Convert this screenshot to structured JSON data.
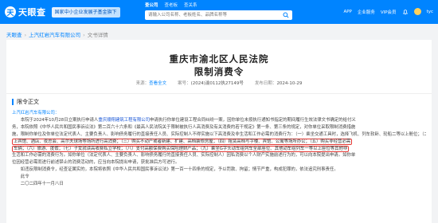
{
  "brand": {
    "logo_glyph": "天",
    "name": "天眼查",
    "banner": "国家中小企业发展子基金旗下"
  },
  "search": {
    "tabs": [
      "查公司",
      "查老板",
      "查关系"
    ],
    "placeholder": "请输入公司名称、老板姓名、品牌名称等"
  },
  "nav": {
    "app": "APP",
    "service": "企业服务",
    "vip": "VIP会员",
    "user": "tyc"
  },
  "breadcrumb": {
    "home": "天眼查",
    "company": "上汽红岩汽车有限公司",
    "current": "文书详情"
  },
  "document": {
    "court": "重庆市渝北区人民法院",
    "title": "限制消费令",
    "source_label": "来源：",
    "source": "查看全文",
    "case_label": "案号：",
    "case_no": "(2024)渝0112执27149号",
    "date_label": "发布日期：",
    "date": "2024-10-29",
    "section": "限令正文"
  },
  "body": {
    "l1": "上汽红岩汽车有限公司：",
    "l2a": "本院于2024年10月28日立案执行申请人",
    "l2b": "重庆顺翔建筑工程有限公司",
    "l2c": "申请执行你单位建设工程合同纠纷一案，因你单位未按执行通知书指定的期间履行生效法律文书确定的给付义",
    "l3": "务，本院依照《中华人民共和国民事诉讼法》第二百六十六条和《最高人民法院关于限制被执行人高消费及有关消费的若干规定》第一条、第三条的规定，对你单位采取限制消费措施",
    "l4": "施，限制你单位及你单位法定代表人、主要负责人、影响债务履行的直接责任人员、实际控制人不得实施以下高消费及非生活和工作必需的消费行为：（一）乘坐交通工具时，选择飞机、列车软卧、轮船二等以上舱位；（二）在星级以",
    "l5a": "上宾馆、酒店、夜总会、高尔夫球场等场所进行高消费；（三）购买不动产或者新建、扩建、高档装修房屋；（四）租赁高档写字楼、宾馆、公寓等场所办公；（五）购买非经营必需",
    "l5b": "车辆；（六）旅游、度假；（七）子女就读高收费私立学校；（八）支付高额保费购买保险理财产品；（九）乘坐G字头动车组列车全部座位、其他动车组列车一等以上座位等其他非",
    "l6": "生活和工作必需的消费行为。如你单位（法定代表人、主要负责人、影响债务履行的直接责任人员、实际控制人）因私消费以个人财产实施前述行为的，可以向本院提出申请。如你单",
    "l7": "位因经营必需而进行前述禁止的消费活动的，应当向本院提出申请，获批准后方可进行。",
    "l8": "如违反限制消费令，经查证属实的，本院将依照《中华人民共和国民事诉讼法》第一百一十四条的规定，予以罚款、拘留；情节严重，构成犯罪的，依法追究刑事责任。",
    "l9": "此令",
    "l10": "二〇二四年十一月八日"
  },
  "colors": {
    "brand_blue": "#0084ff",
    "highlight_box": "#e53935"
  }
}
